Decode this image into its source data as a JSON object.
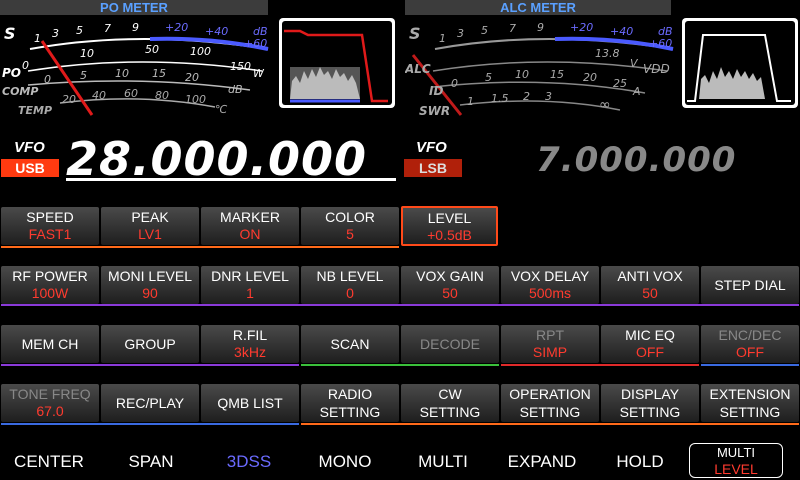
{
  "meters": {
    "po_title": "PO METER",
    "alc_title": "ALC METER",
    "po": {
      "s_label": "S",
      "s_scale": [
        "1",
        "3",
        "5",
        "7",
        "9",
        "+20",
        "+40",
        "+60",
        "dB"
      ],
      "po_label": "PO",
      "po_scale": [
        "0",
        "10",
        "50",
        "100",
        "150",
        "W"
      ],
      "comp_label": "COMP",
      "comp_scale": [
        "0",
        "5",
        "10",
        "15",
        "20",
        "dB"
      ],
      "temp_label": "TEMP",
      "temp_scale": [
        "20",
        "40",
        "60",
        "80",
        "100",
        "℃"
      ]
    },
    "alc": {
      "s_label": "S",
      "s_scale": [
        "1",
        "3",
        "5",
        "7",
        "9",
        "+20",
        "+40",
        "+60",
        "dB"
      ],
      "alc_label": "ALC",
      "vdd_scale": [
        "13.8",
        "V",
        "VDD"
      ],
      "id_label": "ID",
      "id_scale": [
        "0",
        "5",
        "10",
        "15",
        "20",
        "25",
        "A"
      ],
      "swr_label": "SWR",
      "swr_scale": [
        "1",
        "1.5",
        "2",
        "3",
        "∞"
      ]
    }
  },
  "vfo_main": {
    "tag": "VFO",
    "mode": "USB",
    "freq": "28.000.000"
  },
  "vfo_sub": {
    "tag": "VFO",
    "mode": "LSB",
    "freq": "7.000.000"
  },
  "row1": [
    {
      "title": "SPEED",
      "value": "FAST1"
    },
    {
      "title": "PEAK",
      "value": "LV1"
    },
    {
      "title": "MARKER",
      "value": "ON"
    },
    {
      "title": "COLOR",
      "value": "5"
    },
    {
      "title": "LEVEL",
      "value": "+0.5dB"
    }
  ],
  "row2": [
    {
      "title": "RF POWER",
      "value": "100W"
    },
    {
      "title": "MONI LEVEL",
      "value": "90"
    },
    {
      "title": "DNR LEVEL",
      "value": "1"
    },
    {
      "title": "NB LEVEL",
      "value": "0"
    },
    {
      "title": "VOX GAIN",
      "value": "50"
    },
    {
      "title": "VOX DELAY",
      "value": "500ms"
    },
    {
      "title": "ANTI VOX",
      "value": "50"
    },
    {
      "title": "STEP DIAL",
      "value": ""
    }
  ],
  "row3": [
    {
      "title": "MEM CH",
      "value": ""
    },
    {
      "title": "GROUP",
      "value": ""
    },
    {
      "title": "R.FIL",
      "value": "3kHz"
    },
    {
      "title": "SCAN",
      "value": ""
    },
    {
      "title": "DECODE",
      "value": ""
    },
    {
      "title": "RPT",
      "value": "SIMP"
    },
    {
      "title": "MIC EQ",
      "value": "OFF"
    },
    {
      "title": "ENC/DEC",
      "value": "OFF"
    }
  ],
  "row4": [
    {
      "title": "TONE FREQ",
      "value": "67.0"
    },
    {
      "title": "REC/PLAY",
      "value": ""
    },
    {
      "title": "QMB LIST",
      "value": ""
    },
    {
      "title": "RADIO",
      "title2": "SETTING"
    },
    {
      "title": "CW",
      "title2": "SETTING"
    },
    {
      "title": "OPERATION",
      "title2": "SETTING"
    },
    {
      "title": "DISPLAY",
      "title2": "SETTING"
    },
    {
      "title": "EXTENSION",
      "title2": "SETTING"
    }
  ],
  "bottom": [
    "CENTER",
    "SPAN",
    "3DSS",
    "MONO",
    "MULTI",
    "EXPAND",
    "HOLD"
  ],
  "multi": {
    "top": "MULTI",
    "bottom": "LEVEL"
  },
  "colors": {
    "accent_red": "#ff3b2f",
    "accent_blue": "#6b6bff",
    "line_orange": "#ff6a1a",
    "line_purple": "#8a3ad8",
    "line_blue": "#3a6ae0",
    "line_green": "#3ac03a",
    "line_red": "#e02a2a"
  }
}
